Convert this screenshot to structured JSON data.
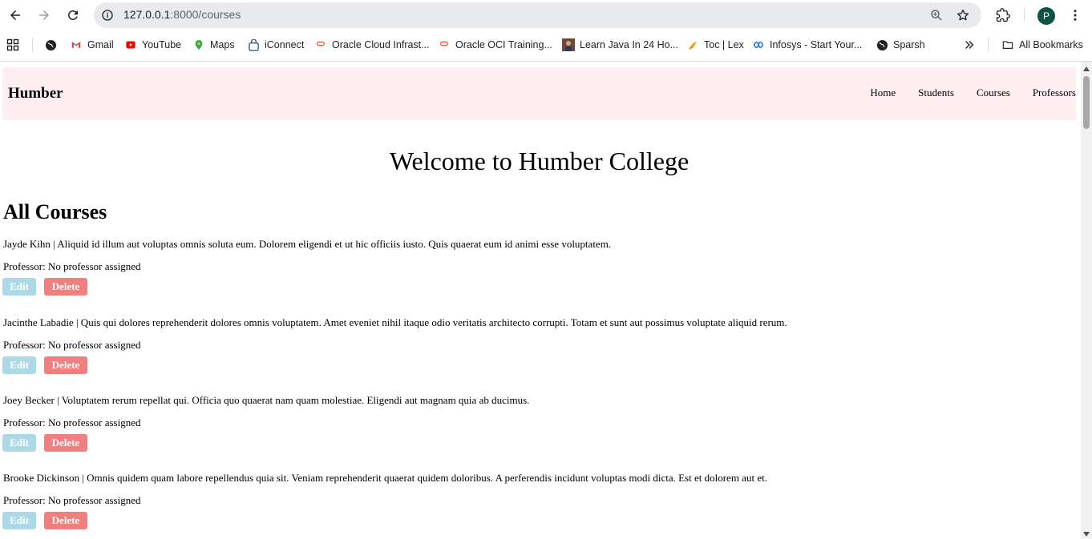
{
  "browser": {
    "url_host": "127.0.0.1",
    "url_path": ":8000/courses",
    "profile_initial": "P",
    "bookmarks": [
      {
        "label": "Gmail",
        "icon": "gmail-icon"
      },
      {
        "label": "YouTube",
        "icon": "youtube-icon"
      },
      {
        "label": "Maps",
        "icon": "maps-icon"
      },
      {
        "label": "iConnect",
        "icon": "iconnect-icon"
      },
      {
        "label": "Oracle Cloud Infrast...",
        "icon": "oracle-icon"
      },
      {
        "label": "Oracle OCI Training...",
        "icon": "oracle-icon"
      },
      {
        "label": "Learn Java In 24 Ho...",
        "icon": "java-thumb-icon"
      },
      {
        "label": "Toc | Lex",
        "icon": "lex-icon"
      },
      {
        "label": "Infosys - Start Your...",
        "icon": "infosys-icon"
      },
      {
        "label": "Sparsh",
        "icon": "globe-icon"
      }
    ],
    "all_bookmarks": "All Bookmarks"
  },
  "site": {
    "brand": "Humber",
    "nav": [
      "Home",
      "Students",
      "Courses",
      "Professors"
    ],
    "welcome": "Welcome to Humber College",
    "section_title": "All Courses"
  },
  "courses": [
    {
      "description": "Jayde Kihn | Aliquid id illum aut voluptas omnis soluta eum. Dolorem eligendi et ut hic officiis iusto. Quis quaerat eum id animi esse voluptatem.",
      "professor": "Professor: No professor assigned",
      "edit_label": "Edit",
      "delete_label": "Delete"
    },
    {
      "description": "Jacinthe Labadie | Quis qui dolores reprehenderit dolores omnis voluptatem. Amet eveniet nihil itaque odio veritatis architecto corrupti. Totam et sunt aut possimus voluptate aliquid rerum.",
      "professor": "Professor: No professor assigned",
      "edit_label": "Edit",
      "delete_label": "Delete"
    },
    {
      "description": "Joey Becker | Voluptatem rerum repellat qui. Officia quo quaerat nam quam molestiae. Eligendi aut magnam quia ab ducimus.",
      "professor": "Professor: No professor assigned",
      "edit_label": "Edit",
      "delete_label": "Delete"
    },
    {
      "description": "Brooke Dickinson | Omnis quidem quam labore repellendus quia sit. Veniam reprehenderit quaerat quidem doloribus. A perferendis incidunt voluptas modi dicta. Est et dolorem aut et.",
      "professor": "Professor: No professor assigned",
      "edit_label": "Edit",
      "delete_label": "Delete"
    }
  ],
  "colors": {
    "header_bg": "#ffeef2",
    "edit_button": "#add8e6",
    "delete_button": "#f08080"
  }
}
